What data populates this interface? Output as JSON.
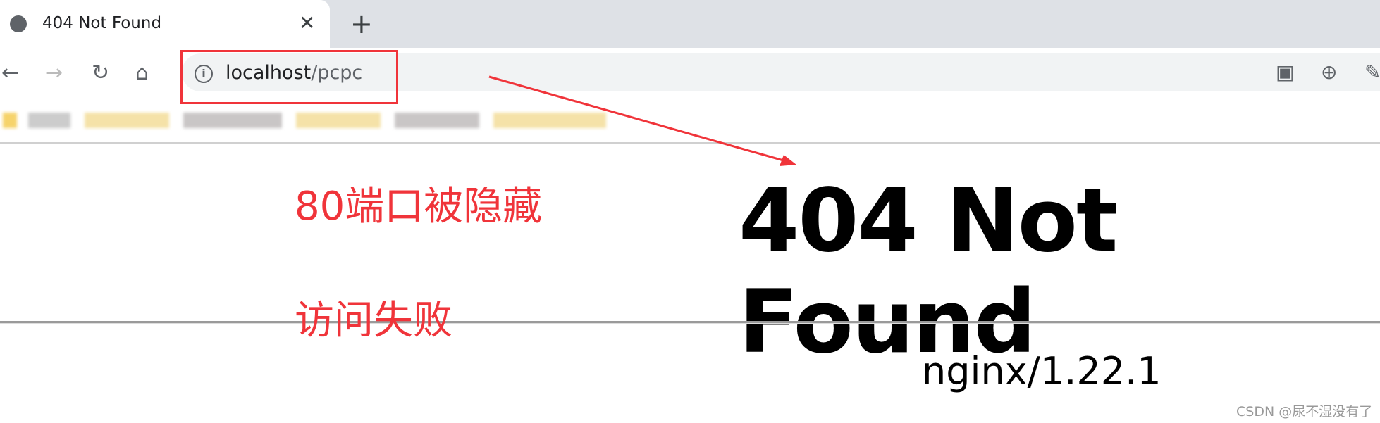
{
  "tab": {
    "title": "404 Not Found",
    "close_icon": "close-icon",
    "new_tab_icon": "plus-icon"
  },
  "toolbar": {
    "url_host": "localhost",
    "url_path": "/pcpc"
  },
  "annotations": {
    "line1": "80端口被隐藏",
    "line2": "访问失败",
    "color": "#f0343a"
  },
  "page": {
    "heading": "404 Not Found",
    "server": "nginx/1.22.1"
  },
  "watermark": "CSDN @尿不湿没有了"
}
